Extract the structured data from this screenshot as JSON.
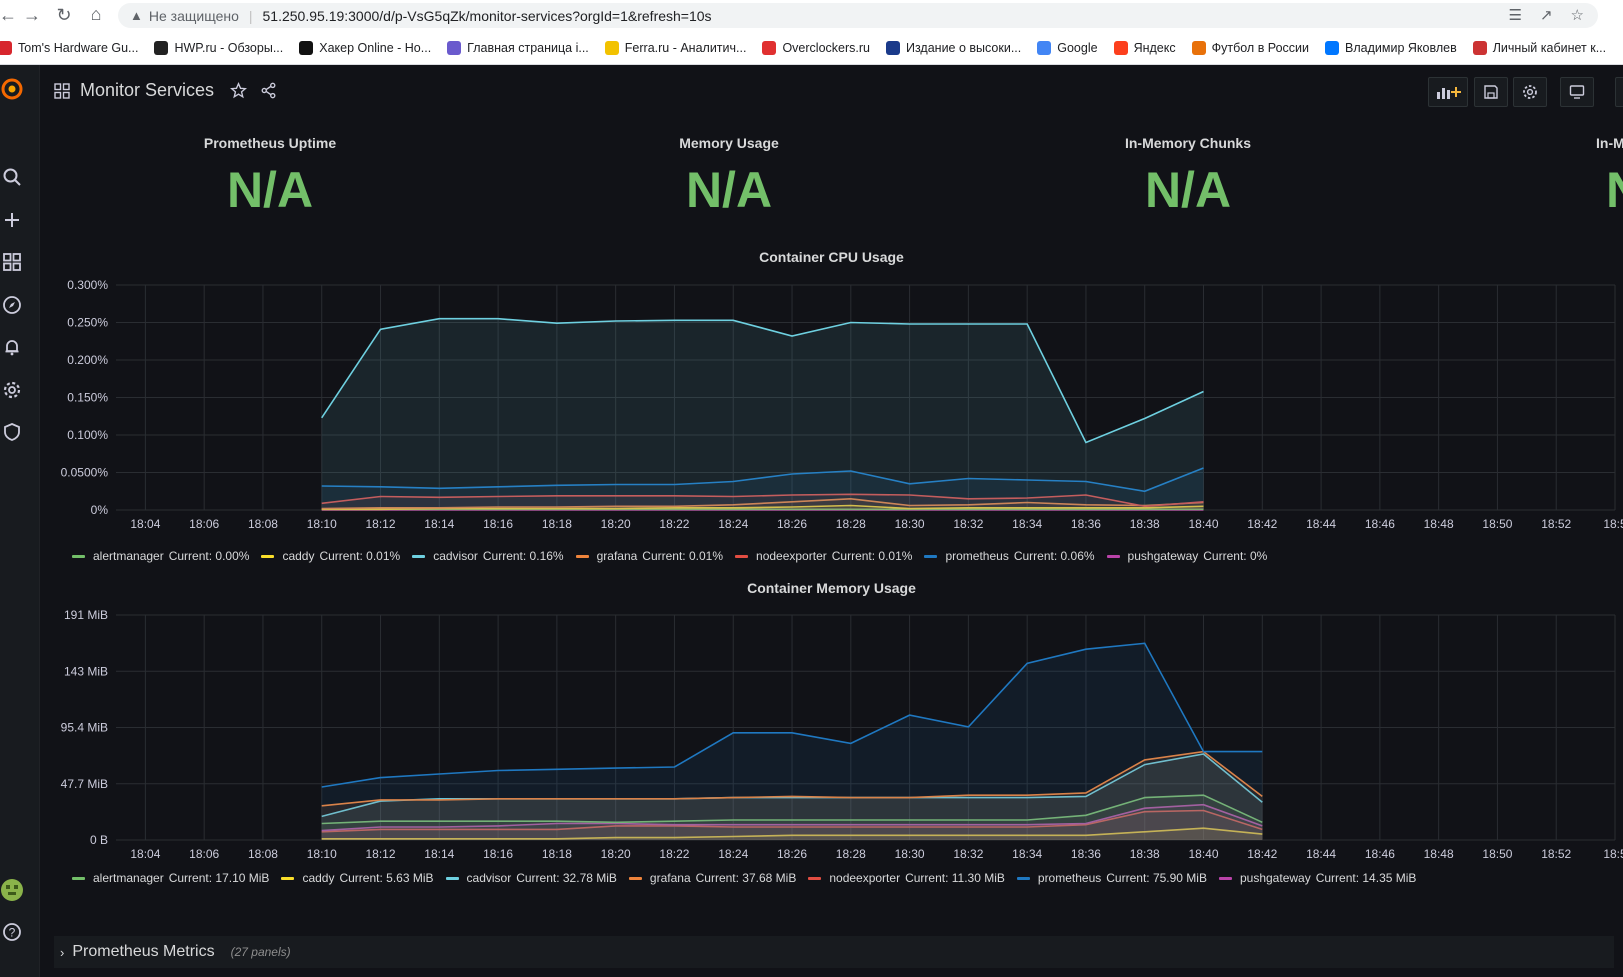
{
  "browser": {
    "insecure_label": "Не защищено",
    "url": "51.250.95.19:3000/d/p-VsG5qZk/monitor-services?orgId=1&refresh=10s",
    "bookmarks": [
      {
        "label": "Tom's Hardware Gu...",
        "color": "#d7262d",
        "icon": "tomshardware-icon"
      },
      {
        "label": "HWP.ru - Обзоры...",
        "color": "#222222",
        "icon": "hwp-icon"
      },
      {
        "label": "Хакер Online - Но...",
        "color": "#111111",
        "icon": "xakep-icon"
      },
      {
        "label": "Главная страница i...",
        "color": "#6a5acd",
        "icon": "ixbt-icon"
      },
      {
        "label": "Ferra.ru - Аналитич...",
        "color": "#f2c200",
        "icon": "ferra-icon"
      },
      {
        "label": "Overclockers.ru",
        "color": "#e03030",
        "icon": "overclockers-icon"
      },
      {
        "label": "Издание о высоки...",
        "color": "#1a3a8a",
        "icon": "habr-icon"
      },
      {
        "label": "Google",
        "color": "#4285f4",
        "icon": "google-icon"
      },
      {
        "label": "Яндекс",
        "color": "#fc3f1d",
        "icon": "yandex-icon"
      },
      {
        "label": "Футбол в России",
        "color": "#e8710a",
        "icon": "football-icon"
      },
      {
        "label": "Владимир Яковлев",
        "color": "#0077ff",
        "icon": "vk-icon"
      },
      {
        "label": "Личный кабинет к...",
        "color": "#cc3333",
        "icon": "cabinet-icon"
      }
    ]
  },
  "dashboard": {
    "title": "Monitor Services"
  },
  "stats": [
    {
      "title": "Prometheus Uptime",
      "value": "N/A"
    },
    {
      "title": "Memory Usage",
      "value": "N/A"
    },
    {
      "title": "In-Memory Chunks",
      "value": "N/A"
    },
    {
      "title": "In-M",
      "value": "N"
    }
  ],
  "colors": {
    "alertmanager": "#73bf69",
    "caddy": "#fade2a",
    "cadvisor": "#6ed0e0",
    "grafana": "#ef843c",
    "nodeexporter": "#e24d42",
    "prometheus": "#1f78c1",
    "pushgateway": "#ba43a9",
    "stat_value": "#73bf69"
  },
  "cpu_panel": {
    "title": "Container CPU Usage",
    "legend": [
      {
        "name": "alertmanager",
        "current": "Current: 0.00%"
      },
      {
        "name": "caddy",
        "current": "Current: 0.01%"
      },
      {
        "name": "cadvisor",
        "current": "Current: 0.16%"
      },
      {
        "name": "grafana",
        "current": "Current: 0.01%"
      },
      {
        "name": "nodeexporter",
        "current": "Current: 0.01%"
      },
      {
        "name": "prometheus",
        "current": "Current: 0.06%"
      },
      {
        "name": "pushgateway",
        "current": "Current: 0%"
      }
    ]
  },
  "mem_panel": {
    "title": "Container Memory Usage",
    "legend": [
      {
        "name": "alertmanager",
        "current": "Current: 17.10 MiB"
      },
      {
        "name": "caddy",
        "current": "Current: 5.63 MiB"
      },
      {
        "name": "cadvisor",
        "current": "Current: 32.78 MiB"
      },
      {
        "name": "grafana",
        "current": "Current: 37.68 MiB"
      },
      {
        "name": "nodeexporter",
        "current": "Current: 11.30 MiB"
      },
      {
        "name": "prometheus",
        "current": "Current: 75.90 MiB"
      },
      {
        "name": "pushgateway",
        "current": "Current: 14.35 MiB"
      }
    ]
  },
  "row": {
    "title": "Prometheus Metrics",
    "count": "(27 panels)"
  },
  "chart_data": [
    {
      "type": "area",
      "title": "Container CPU Usage",
      "x": [
        "18:10",
        "18:12",
        "18:14",
        "18:16",
        "18:18",
        "18:20",
        "18:22",
        "18:24",
        "18:26",
        "18:28",
        "18:30",
        "18:32",
        "18:34",
        "18:36",
        "18:38",
        "18:40"
      ],
      "x_ticks": [
        "18:04",
        "18:06",
        "18:08",
        "18:10",
        "18:12",
        "18:14",
        "18:16",
        "18:18",
        "18:20",
        "18:22",
        "18:24",
        "18:26",
        "18:28",
        "18:30",
        "18:32",
        "18:34",
        "18:36",
        "18:38",
        "18:40",
        "18:42",
        "18:44",
        "18:46",
        "18:48",
        "18:50",
        "18:52",
        "18:5"
      ],
      "x_range": [
        "18:03",
        "18:54"
      ],
      "y_ticks": [
        "0%",
        "0.0500%",
        "0.100%",
        "0.150%",
        "0.200%",
        "0.250%",
        "0.300%"
      ],
      "ylim": [
        0,
        0.3
      ],
      "grid": true,
      "legend": "bottom",
      "series": [
        {
          "name": "cadvisor",
          "values": [
            0.123,
            0.241,
            0.255,
            0.255,
            0.249,
            0.252,
            0.253,
            0.253,
            0.232,
            0.25,
            0.248,
            0.248,
            0.248,
            0.09,
            0.122,
            0.158
          ]
        },
        {
          "name": "prometheus",
          "values": [
            0.032,
            0.031,
            0.029,
            0.031,
            0.033,
            0.034,
            0.034,
            0.038,
            0.048,
            0.052,
            0.035,
            0.042,
            0.04,
            0.038,
            0.025,
            0.056
          ]
        },
        {
          "name": "nodeexporter",
          "values": [
            0.009,
            0.018,
            0.017,
            0.018,
            0.019,
            0.019,
            0.019,
            0.018,
            0.02,
            0.021,
            0.02,
            0.015,
            0.016,
            0.02,
            0.005,
            0.011
          ]
        },
        {
          "name": "grafana",
          "values": [
            0.002,
            0.003,
            0.003,
            0.004,
            0.004,
            0.005,
            0.005,
            0.007,
            0.011,
            0.015,
            0.006,
            0.007,
            0.01,
            0.007,
            0.006,
            0.01
          ]
        },
        {
          "name": "caddy",
          "values": [
            0.001,
            0.001,
            0.002,
            0.002,
            0.002,
            0.002,
            0.003,
            0.003,
            0.004,
            0.006,
            0.002,
            0.003,
            0.003,
            0.003,
            0.003,
            0.005
          ]
        },
        {
          "name": "alertmanager",
          "values": [
            0.001,
            0.001,
            0.001,
            0.001,
            0.001,
            0.001,
            0.001,
            0.001,
            0.001,
            0.001,
            0.001,
            0.001,
            0.001,
            0.001,
            0.001,
            0.001
          ]
        },
        {
          "name": "pushgateway",
          "values": [
            0,
            0,
            0,
            0,
            0,
            0,
            0,
            0,
            0,
            0,
            0,
            0,
            0,
            0,
            0,
            0
          ]
        }
      ]
    },
    {
      "type": "area",
      "title": "Container Memory Usage",
      "x": [
        "18:10",
        "18:12",
        "18:14",
        "18:16",
        "18:18",
        "18:20",
        "18:22",
        "18:24",
        "18:26",
        "18:28",
        "18:30",
        "18:32",
        "18:34",
        "18:36",
        "18:38",
        "18:40",
        "18:42"
      ],
      "x_ticks": [
        "18:04",
        "18:06",
        "18:08",
        "18:10",
        "18:12",
        "18:14",
        "18:16",
        "18:18",
        "18:20",
        "18:22",
        "18:24",
        "18:26",
        "18:28",
        "18:30",
        "18:32",
        "18:34",
        "18:36",
        "18:38",
        "18:40",
        "18:42",
        "18:44",
        "18:46",
        "18:48",
        "18:50",
        "18:52",
        "18:5"
      ],
      "x_range": [
        "18:03",
        "18:54"
      ],
      "y_ticks": [
        "0 B",
        "47.7 MiB",
        "95.4 MiB",
        "143 MiB",
        "191 MiB"
      ],
      "ylim": [
        0,
        191
      ],
      "grid": true,
      "legend": "bottom",
      "series": [
        {
          "name": "prometheus",
          "values": [
            45,
            53,
            56,
            59,
            60,
            61,
            62,
            91,
            91,
            82,
            106,
            96,
            150,
            162,
            167,
            75,
            75
          ]
        },
        {
          "name": "grafana",
          "values": [
            29,
            34,
            34,
            35,
            35,
            35,
            35,
            36,
            37,
            36,
            36,
            38,
            38,
            40,
            68,
            75,
            37
          ]
        },
        {
          "name": "cadvisor",
          "values": [
            20,
            33,
            35,
            35,
            35,
            35,
            35,
            36,
            36,
            36,
            36,
            36,
            36,
            37,
            64,
            73,
            32
          ]
        },
        {
          "name": "alertmanager",
          "values": [
            14,
            16,
            16,
            16,
            16,
            15,
            16,
            17,
            17,
            17,
            17,
            17,
            17,
            21,
            36,
            38,
            15
          ]
        },
        {
          "name": "pushgateway",
          "values": [
            8,
            11,
            11,
            12,
            14,
            14,
            13,
            13,
            13,
            13,
            13,
            13,
            13,
            14,
            27,
            30,
            12
          ]
        },
        {
          "name": "nodeexporter",
          "values": [
            7,
            9,
            9,
            9,
            9,
            12,
            12,
            11,
            11,
            11,
            11,
            11,
            11,
            13,
            24,
            25,
            9
          ]
        },
        {
          "name": "caddy",
          "values": [
            1,
            1,
            1,
            1,
            1,
            2,
            2,
            3,
            4,
            4,
            4,
            4,
            4,
            4,
            7,
            10,
            5
          ]
        }
      ]
    }
  ]
}
